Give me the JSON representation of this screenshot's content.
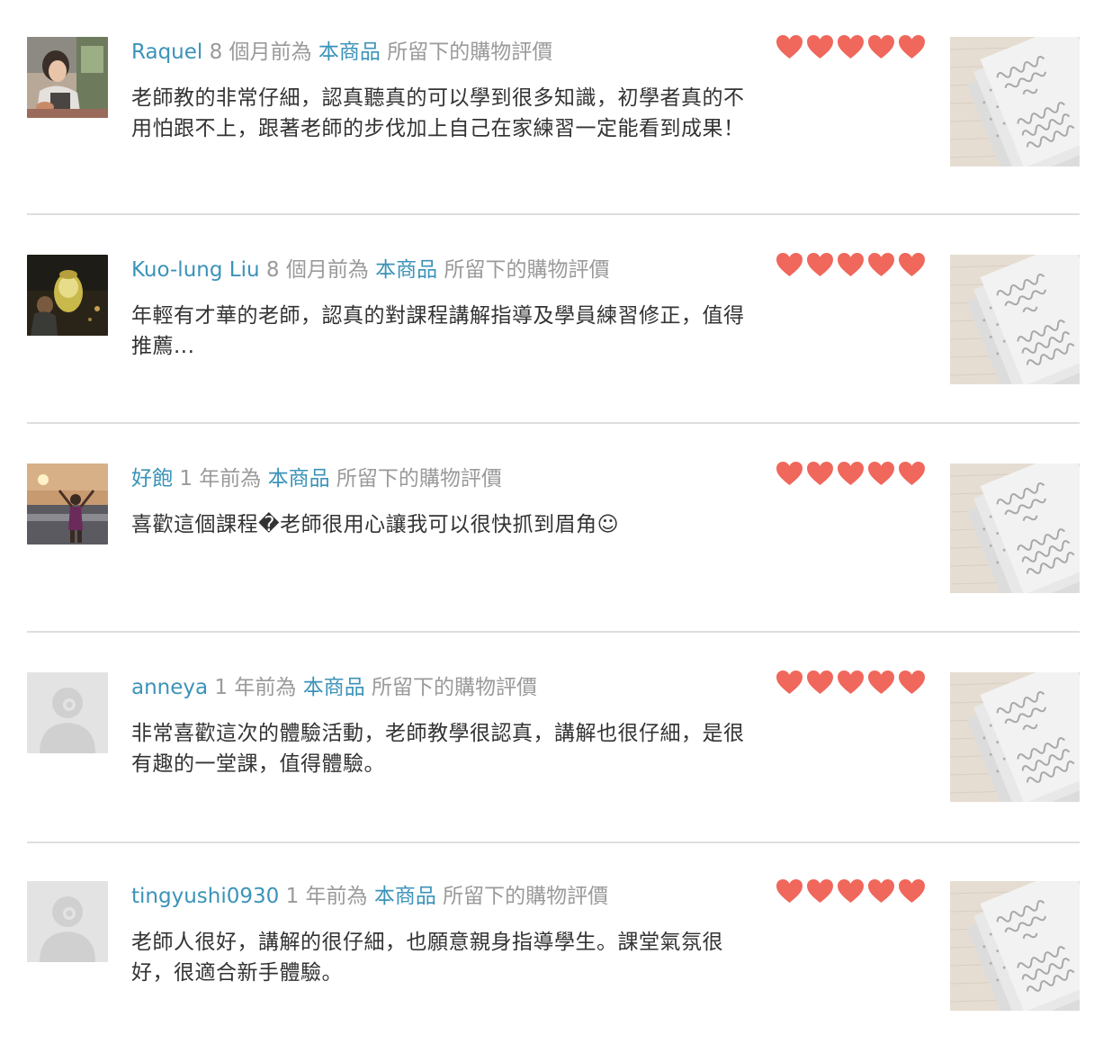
{
  "meta_text": {
    "ago_suffix": "前為",
    "product_link": "本商品",
    "tail": "所留下的購物評價"
  },
  "colors": {
    "link": "#3b93b9",
    "meta_gray": "#9a9a9a",
    "heart": "#f0675c",
    "divider": "#dedede",
    "text": "#333333"
  },
  "reviews": [
    {
      "username": "Raquel",
      "time": "8 個月",
      "comment": "老師教的非常仔細，認真聽真的可以學到很多知識，初學者真的不用怕跟不上，跟著老師的步伐加上自己在家練習一定能看到成果！",
      "rating": 5,
      "avatar_icon": "user-photo-icon",
      "thumb_icon": "product-calligraphy-sheet-icon"
    },
    {
      "username": "Kuo-lung Liu",
      "time": "8 個月",
      "comment": "年輕有才華的老師，認真的對課程講解指導及學員練習修正，值得推薦...",
      "rating": 5,
      "avatar_icon": "user-photo-icon",
      "thumb_icon": "product-calligraphy-sheet-icon"
    },
    {
      "username": "好飽",
      "time": "1 年",
      "comment": "喜歡這個課程�老師很用心讓我可以很快抓到眉角☺",
      "rating": 5,
      "avatar_icon": "user-photo-icon",
      "thumb_icon": "product-calligraphy-sheet-icon"
    },
    {
      "username": "anneya",
      "time": "1 年",
      "comment": "非常喜歡這次的體驗活動，老師教學很認真，講解也很仔細，是很有趣的一堂課，值得體驗。",
      "rating": 5,
      "avatar_icon": "default-avatar-icon",
      "thumb_icon": "product-calligraphy-sheet-icon"
    },
    {
      "username": "tingyushi0930",
      "time": "1 年",
      "comment": "老師人很好，講解的很仔細，也願意親身指導學生。課堂氣氛很好，很適合新手體驗。",
      "rating": 5,
      "avatar_icon": "default-avatar-icon",
      "thumb_icon": "product-calligraphy-sheet-icon"
    }
  ]
}
